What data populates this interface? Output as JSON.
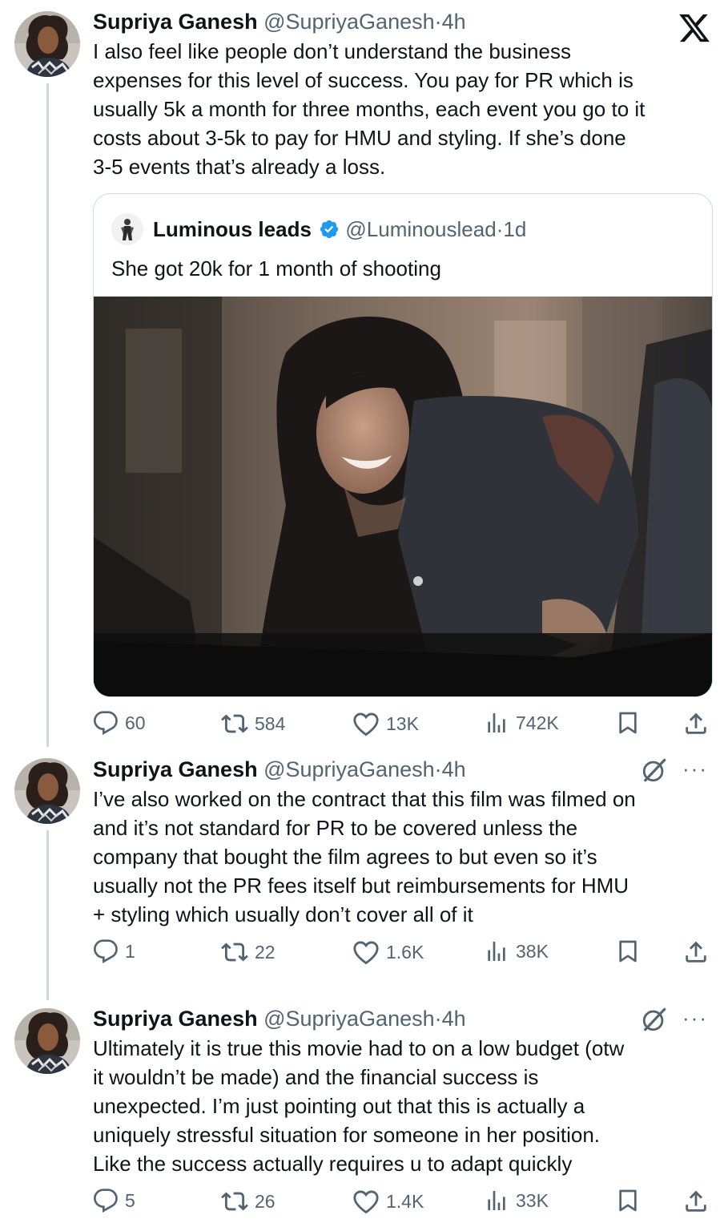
{
  "brand": {
    "logo": "X"
  },
  "tweets": [
    {
      "name": "Supriya Ganesh",
      "handle": "@SupriyaGanesh",
      "separator": "·",
      "time": "4h",
      "text": "I also feel like people don’t understand the business expenses for this level of success.  You pay for PR which is usually 5k a month for three months, each event you go to it costs about 3-5k to pay for HMU and styling. If she’s done 3-5 events that’s already a loss.",
      "lines": [
        "I also feel like people don’t understand the business",
        "expenses for this level of success.  You pay for PR which is",
        "usually 5k a month for three months, each event you go to it",
        "costs about 3-5k to pay for HMU and styling. If she’s done",
        "3-5 events that’s already a loss."
      ],
      "stats": {
        "replies": "60",
        "reposts": "584",
        "likes": "13K",
        "views": "742K"
      },
      "quote": {
        "name": "Luminous leads",
        "verified": true,
        "handle": "@Luminouslead",
        "separator": "·",
        "time": "1d",
        "text": "She got 20k for 1 month of shooting",
        "media": "photo of a smiling woman with long dark hair leaning into a car at night"
      }
    },
    {
      "name": "Supriya Ganesh",
      "handle": "@SupriyaGanesh",
      "separator": "·",
      "time": "4h",
      "lines": [
        "I’ve also worked on the contract that this film was filmed on",
        "and it’s not standard for PR to be covered unless the",
        "company that bought the film agrees to but even so it’s",
        "usually not the PR fees itself but reimbursements for HMU",
        "+ styling which usually don’t cover all of it"
      ],
      "stats": {
        "replies": "1",
        "reposts": "22",
        "likes": "1.6K",
        "views": "38K"
      }
    },
    {
      "name": "Supriya Ganesh",
      "handle": "@SupriyaGanesh",
      "separator": "·",
      "time": "4h",
      "lines": [
        "Ultimately it is true this movie had to on a low budget (otw",
        "it wouldn’t be made) and the financial success is",
        "unexpected. I’m just pointing out that this is actually a",
        "uniquely stressful situation for someone in her position.",
        "Like the success actually requires u to adapt quickly"
      ],
      "stats": {
        "replies": "5",
        "reposts": "26",
        "likes": "1.4K",
        "views": "33K"
      }
    }
  ],
  "icons": {
    "reply": "reply-icon",
    "repost": "repost-icon",
    "like": "heart-icon",
    "views": "views-icon",
    "bookmark": "bookmark-icon",
    "share": "share-icon",
    "grok": "grok-icon",
    "more": "more-icon",
    "verified": "verified-badge-icon",
    "x_logo": "x-logo-icon"
  },
  "more_label": "···",
  "colors": {
    "text": "#0f1419",
    "secondary": "#536471",
    "border": "#cfd9de",
    "verified": "#1d9bf0"
  }
}
